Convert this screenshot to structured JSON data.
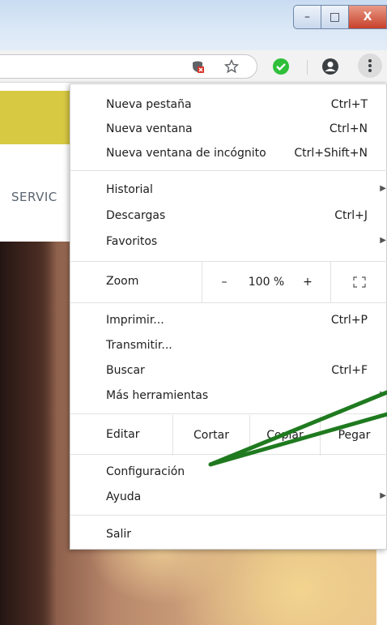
{
  "window": {
    "minimize_glyph": "–",
    "maximize_glyph": "□",
    "close_glyph": "X"
  },
  "toolbar": {
    "icons": [
      "extension-blocked-icon",
      "bookmark-star-icon",
      "security-check-icon",
      "account-icon",
      "menu-dots-icon"
    ]
  },
  "page": {
    "nav_text": "SERVIC",
    "band_color": "#d8c943"
  },
  "menu": {
    "group1": [
      {
        "label": "Nueva pestaña",
        "shortcut": "Ctrl+T"
      },
      {
        "label": "Nueva ventana",
        "shortcut": "Ctrl+N"
      },
      {
        "label": "Nueva ventana de incógnito",
        "shortcut": "Ctrl+Shift+N"
      }
    ],
    "group2": [
      {
        "label": "Historial",
        "has_submenu": true
      },
      {
        "label": "Descargas",
        "shortcut": "Ctrl+J"
      },
      {
        "label": "Favoritos",
        "has_submenu": true
      }
    ],
    "zoom": {
      "label": "Zoom",
      "minus": "–",
      "value": "100 %",
      "plus": "+"
    },
    "group3": [
      {
        "label": "Imprimir...",
        "shortcut": "Ctrl+P"
      },
      {
        "label": "Transmitir..."
      },
      {
        "label": "Buscar",
        "shortcut": "Ctrl+F"
      },
      {
        "label": "Más herramientas",
        "has_submenu": true
      }
    ],
    "edit": {
      "label": "Editar",
      "cut": "Cortar",
      "copy": "Copiar",
      "paste": "Pegar"
    },
    "group4": [
      {
        "label": "Configuración"
      },
      {
        "label": "Ayuda",
        "has_submenu": true
      }
    ],
    "exit": {
      "label": "Salir"
    }
  },
  "annotation_color": "#1f7a1f"
}
